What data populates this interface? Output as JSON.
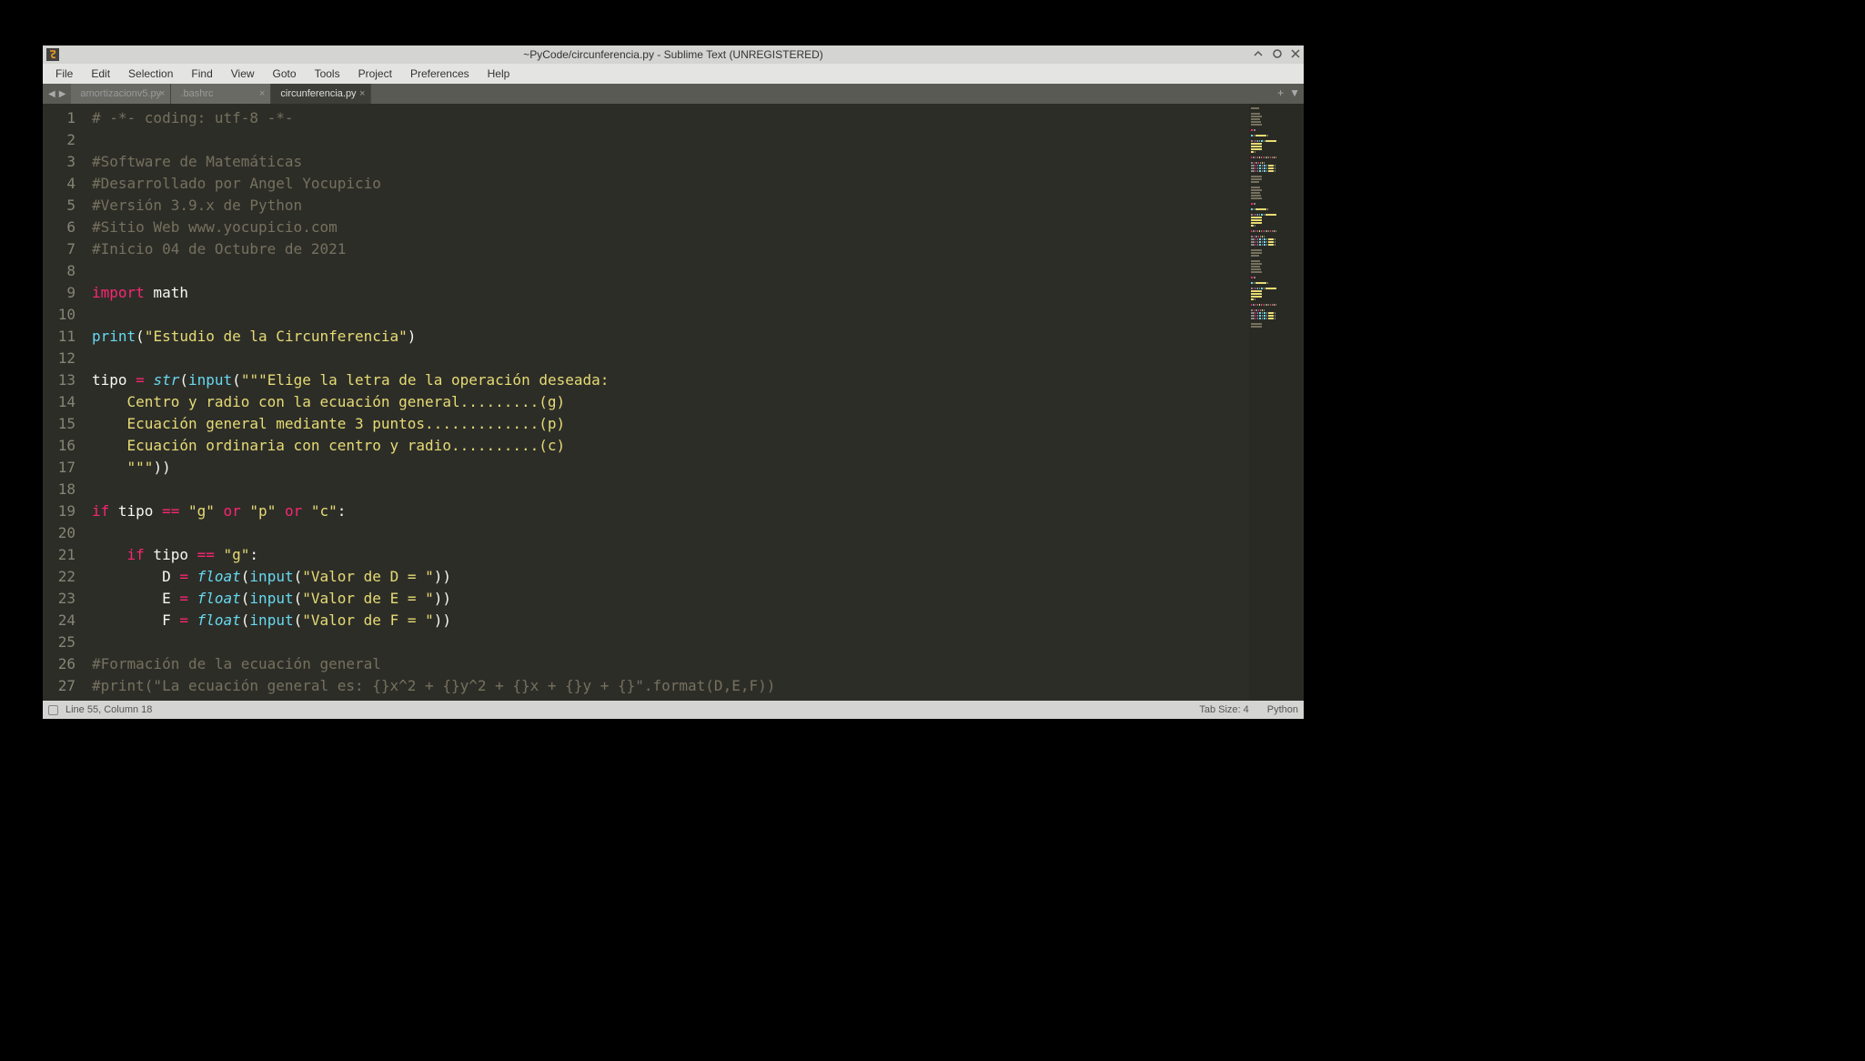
{
  "window": {
    "title": "~PyCode/circunferencia.py - Sublime Text (UNREGISTERED)"
  },
  "menu": {
    "items": [
      "File",
      "Edit",
      "Selection",
      "Find",
      "View",
      "Goto",
      "Tools",
      "Project",
      "Preferences",
      "Help"
    ]
  },
  "tabs": {
    "items": [
      {
        "label": "amortizacionv5.py",
        "active": false
      },
      {
        "label": ".bashrc",
        "active": false
      },
      {
        "label": "circunferencia.py",
        "active": true
      }
    ]
  },
  "editor": {
    "line_start": 1,
    "line_end": 27,
    "lines": [
      [
        {
          "cls": "c-comment",
          "t": "# -*- coding: utf-8 -*-"
        }
      ],
      [],
      [
        {
          "cls": "c-comment",
          "t": "#Software de Matemáticas"
        }
      ],
      [
        {
          "cls": "c-comment",
          "t": "#Desarrollado por Angel Yocupicio"
        }
      ],
      [
        {
          "cls": "c-comment",
          "t": "#Versión 3.9.x de Python"
        }
      ],
      [
        {
          "cls": "c-comment",
          "t": "#Sitio Web www.yocupicio.com"
        }
      ],
      [
        {
          "cls": "c-comment",
          "t": "#Inicio 04 de Octubre de 2021"
        }
      ],
      [],
      [
        {
          "cls": "c-keyword",
          "t": "import"
        },
        {
          "cls": "c-text",
          "t": " math"
        }
      ],
      [],
      [
        {
          "cls": "c-func",
          "t": "print"
        },
        {
          "cls": "c-punct",
          "t": "("
        },
        {
          "cls": "c-string",
          "t": "\"Estudio de la Circunferencia\""
        },
        {
          "cls": "c-punct",
          "t": ")"
        }
      ],
      [],
      [
        {
          "cls": "c-text",
          "t": "tipo "
        },
        {
          "cls": "c-keyword",
          "t": "="
        },
        {
          "cls": "c-text",
          "t": " "
        },
        {
          "cls": "c-builtin",
          "t": "str"
        },
        {
          "cls": "c-punct",
          "t": "("
        },
        {
          "cls": "c-func",
          "t": "input"
        },
        {
          "cls": "c-punct",
          "t": "("
        },
        {
          "cls": "c-string",
          "t": "\"\"\"Elige la letra de la operación deseada:"
        }
      ],
      [
        {
          "cls": "c-string",
          "t": "    Centro y radio con la ecuación general.........(g)"
        }
      ],
      [
        {
          "cls": "c-string",
          "t": "    Ecuación general mediante 3 puntos.............(p)"
        }
      ],
      [
        {
          "cls": "c-string",
          "t": "    Ecuación ordinaria con centro y radio..........(c)"
        }
      ],
      [
        {
          "cls": "c-string",
          "t": "    \"\"\""
        },
        {
          "cls": "c-punct",
          "t": "))"
        }
      ],
      [],
      [
        {
          "cls": "c-keyword",
          "t": "if"
        },
        {
          "cls": "c-text",
          "t": " tipo "
        },
        {
          "cls": "c-keyword",
          "t": "=="
        },
        {
          "cls": "c-text",
          "t": " "
        },
        {
          "cls": "c-string",
          "t": "\"g\""
        },
        {
          "cls": "c-text",
          "t": " "
        },
        {
          "cls": "c-keyword",
          "t": "or"
        },
        {
          "cls": "c-text",
          "t": " "
        },
        {
          "cls": "c-string",
          "t": "\"p\""
        },
        {
          "cls": "c-text",
          "t": " "
        },
        {
          "cls": "c-keyword",
          "t": "or"
        },
        {
          "cls": "c-text",
          "t": " "
        },
        {
          "cls": "c-string",
          "t": "\"c\""
        },
        {
          "cls": "c-punct",
          "t": ":"
        }
      ],
      [],
      [
        {
          "cls": "c-text",
          "t": "    "
        },
        {
          "cls": "c-keyword",
          "t": "if"
        },
        {
          "cls": "c-text",
          "t": " tipo "
        },
        {
          "cls": "c-keyword",
          "t": "=="
        },
        {
          "cls": "c-text",
          "t": " "
        },
        {
          "cls": "c-string",
          "t": "\"g\""
        },
        {
          "cls": "c-punct",
          "t": ":"
        }
      ],
      [
        {
          "cls": "c-text",
          "t": "        D "
        },
        {
          "cls": "c-keyword",
          "t": "="
        },
        {
          "cls": "c-text",
          "t": " "
        },
        {
          "cls": "c-builtin",
          "t": "float"
        },
        {
          "cls": "c-punct",
          "t": "("
        },
        {
          "cls": "c-func",
          "t": "input"
        },
        {
          "cls": "c-punct",
          "t": "("
        },
        {
          "cls": "c-string",
          "t": "\"Valor de D = \""
        },
        {
          "cls": "c-punct",
          "t": "))"
        }
      ],
      [
        {
          "cls": "c-text",
          "t": "        E "
        },
        {
          "cls": "c-keyword",
          "t": "="
        },
        {
          "cls": "c-text",
          "t": " "
        },
        {
          "cls": "c-builtin",
          "t": "float"
        },
        {
          "cls": "c-punct",
          "t": "("
        },
        {
          "cls": "c-func",
          "t": "input"
        },
        {
          "cls": "c-punct",
          "t": "("
        },
        {
          "cls": "c-string",
          "t": "\"Valor de E = \""
        },
        {
          "cls": "c-punct",
          "t": "))"
        }
      ],
      [
        {
          "cls": "c-text",
          "t": "        F "
        },
        {
          "cls": "c-keyword",
          "t": "="
        },
        {
          "cls": "c-text",
          "t": " "
        },
        {
          "cls": "c-builtin",
          "t": "float"
        },
        {
          "cls": "c-punct",
          "t": "("
        },
        {
          "cls": "c-func",
          "t": "input"
        },
        {
          "cls": "c-punct",
          "t": "("
        },
        {
          "cls": "c-string",
          "t": "\"Valor de F = \""
        },
        {
          "cls": "c-punct",
          "t": "))"
        }
      ],
      [],
      [
        {
          "cls": "c-comment",
          "t": "#Formación de la ecuación general"
        }
      ],
      [
        {
          "cls": "c-comment",
          "t": "#print(\"La ecuación general es: {}x^2 + {}y^2 + {}x + {}y + {}\".format(D,E,F))"
        }
      ]
    ]
  },
  "statusbar": {
    "position": "Line 55, Column 18",
    "tab_size": "Tab Size: 4",
    "syntax": "Python"
  }
}
